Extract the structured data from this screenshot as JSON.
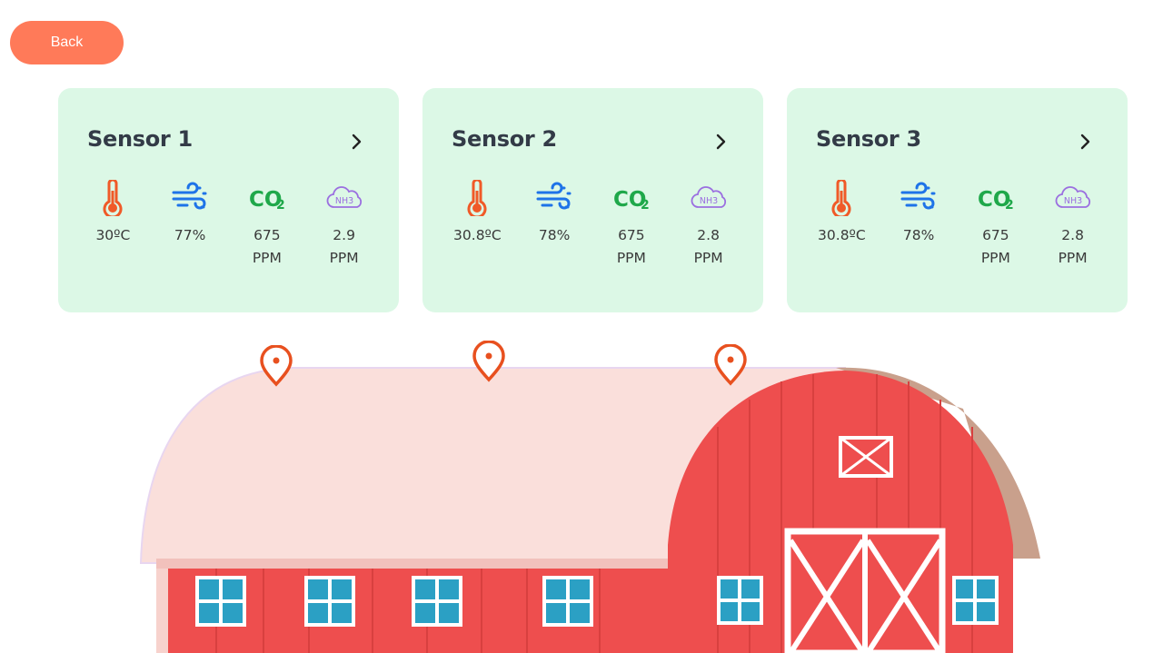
{
  "back_label": "Back",
  "sensors": [
    {
      "title": "Sensor 1",
      "temperature": "30ºC",
      "humidity": "77%",
      "co2": "675\nPPM",
      "nh3": "2.9\nPPM"
    },
    {
      "title": "Sensor 2",
      "temperature": "30.8ºC",
      "humidity": "78%",
      "co2": "675\nPPM",
      "nh3": "2.8\nPPM"
    },
    {
      "title": "Sensor 3",
      "temperature": "30.8ºC",
      "humidity": "78%",
      "co2": "675\nPPM",
      "nh3": "2.8\nPPM"
    }
  ],
  "icons": {
    "temperature": "thermometer-icon",
    "humidity": "wind-icon",
    "co2": "co2-icon",
    "nh3": "nh3-cloud-icon",
    "pin": "location-pin-icon"
  },
  "icon_text": {
    "co2": "CO",
    "co2_sub": "2",
    "nh3": "NH3"
  },
  "colors": {
    "back_button": "#ff7a59",
    "card_bg": "#dcf8e6",
    "thermometer": "#f05a28",
    "wind": "#1e73e8",
    "co2": "#1fa84a",
    "nh3": "#9b6fe0",
    "pin": "#e8501f",
    "barn_red": "#ee4e4e",
    "roof_pink": "#fadfdb"
  }
}
